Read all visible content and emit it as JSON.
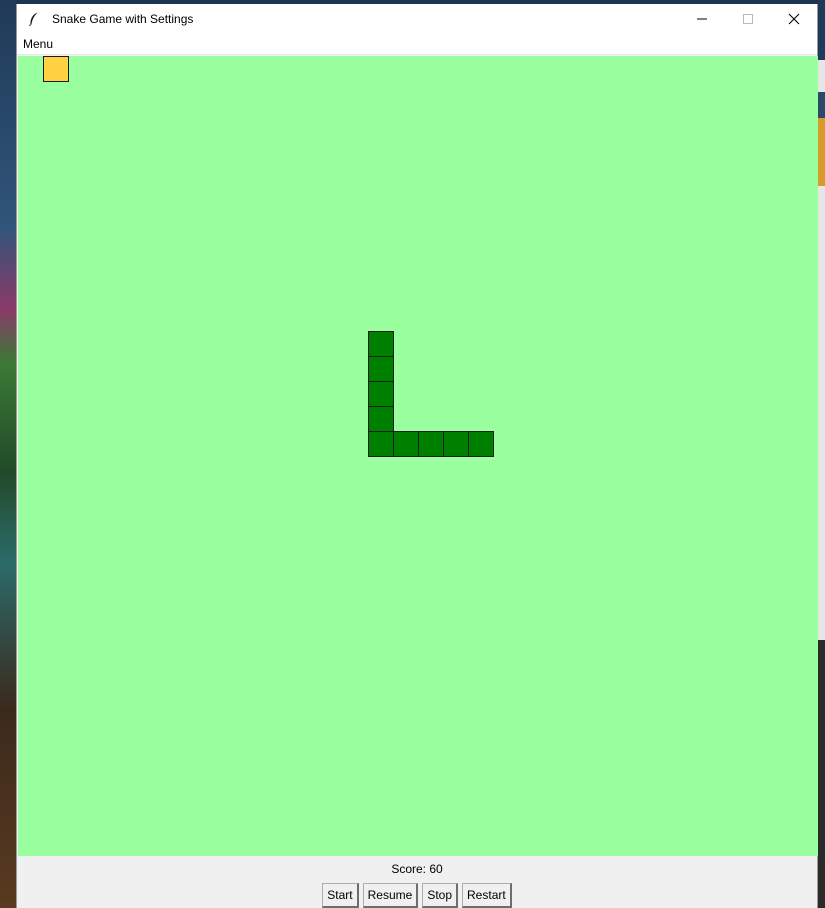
{
  "window": {
    "title": "Snake Game with Settings",
    "controls": {
      "minimize": "—",
      "maximize": "☐",
      "close": "✕"
    }
  },
  "menubar": {
    "menu_label": "Menu"
  },
  "board": {
    "background": "#99ff9f",
    "cell_count": 32,
    "snake_color": "#008000",
    "food_color": "#ffd243",
    "food": [
      1,
      0
    ],
    "snake": [
      [
        14,
        11
      ],
      [
        14,
        12
      ],
      [
        14,
        13
      ],
      [
        14,
        14
      ],
      [
        14,
        15
      ],
      [
        15,
        15
      ],
      [
        16,
        15
      ],
      [
        17,
        15
      ],
      [
        18,
        15
      ]
    ]
  },
  "status": {
    "score_text": "Score: 60",
    "buttons": {
      "start": "Start",
      "resume": "Resume",
      "stop": "Stop",
      "restart": "Restart"
    }
  }
}
